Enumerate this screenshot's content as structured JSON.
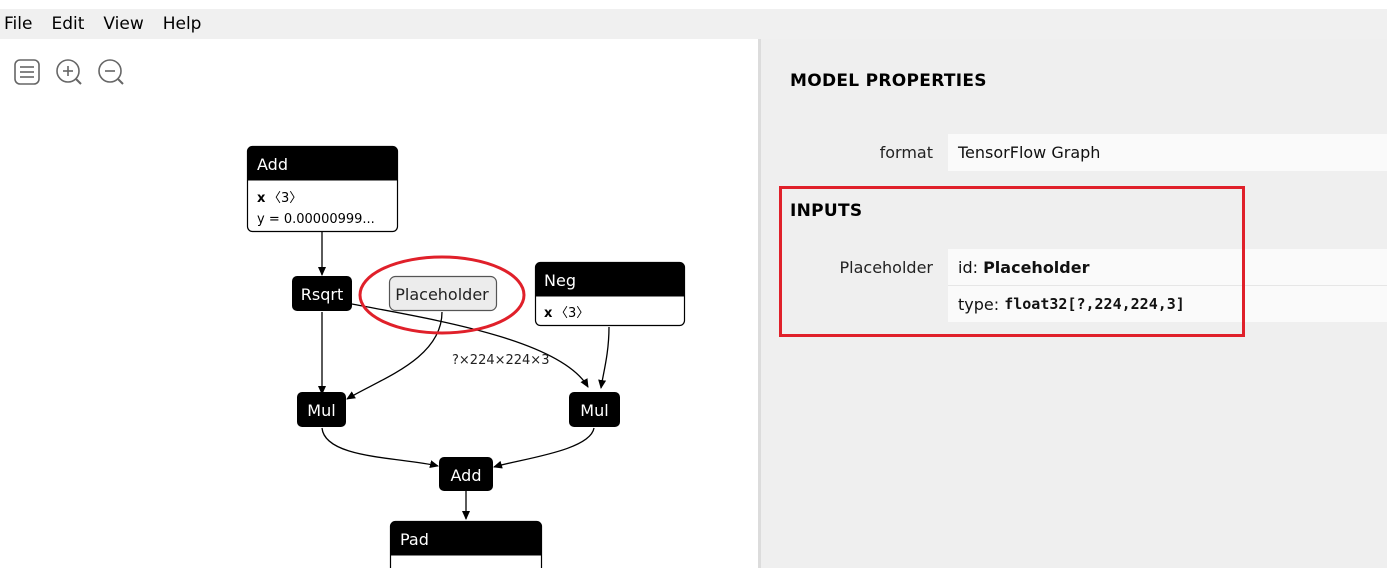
{
  "menubar": {
    "items": [
      "File",
      "Edit",
      "View",
      "Help"
    ]
  },
  "toolbar": {
    "icons": [
      "list-icon",
      "zoom-in-icon",
      "zoom-out-icon"
    ]
  },
  "graph": {
    "nodes": {
      "add_top": {
        "title": "Add",
        "attr1_name": "x",
        "attr1_value": "〈3〉",
        "attr2": "y = 0.00000999..."
      },
      "rsqrt": {
        "title": "Rsqrt"
      },
      "placeholder": {
        "title": "Placeholder"
      },
      "neg": {
        "title": "Neg",
        "attr1_name": "x",
        "attr1_value": "〈3〉"
      },
      "mul_left": {
        "title": "Mul"
      },
      "mul_right": {
        "title": "Mul"
      },
      "add_bottom": {
        "title": "Add"
      },
      "pad": {
        "title": "Pad"
      }
    },
    "edge_label": "?×224×224×3"
  },
  "properties": {
    "model_title": "MODEL PROPERTIES",
    "format_label": "format",
    "format_value": "TensorFlow Graph",
    "inputs_title": "INPUTS",
    "input_name": "Placeholder",
    "id_prefix": "id: ",
    "id_value": "Placeholder",
    "type_prefix": "type: ",
    "type_value": "float32[?,224,224,3]"
  },
  "colors": {
    "highlight": "#e0202a",
    "node_header": "#000000",
    "menubar_bg": "#f0f0f0",
    "props_bg": "#efefef"
  }
}
